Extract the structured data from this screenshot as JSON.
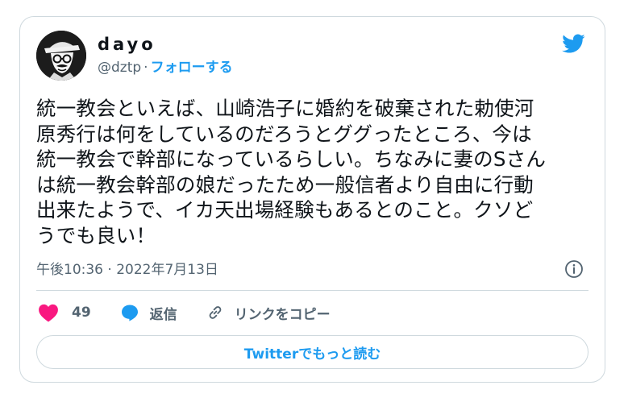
{
  "author": {
    "display_name": "dayo",
    "handle": "@dztp",
    "separator": "·",
    "follow_label": "フォローする"
  },
  "tweet": {
    "text": "統一教会といえば、山崎浩子に婚約を破棄された勅使河\n原秀行は何をしているのだろうとググったところ、今は\n統一教会で幹部になっているらしい。ちなみに妻のSさん\nは統一教会幹部の娘だったため一般信者より自由に行動\n出来たようで、イカ天出場経験もあるとのこと。クソど\nうでも良い！",
    "timestamp": "午後10:36 · 2022年7月13日"
  },
  "actions": {
    "like_count": "49",
    "reply_label": "返信",
    "copy_link_label": "リンクをコピー"
  },
  "read_more_label": "Twitterでもっと読む",
  "colors": {
    "accent": "#1d9bf0",
    "like": "#f91880",
    "secondary_text": "#536471",
    "border": "#cfd9de"
  },
  "icons": {
    "brand": "twitter-bird-icon",
    "info": "info-icon",
    "like": "heart-icon",
    "reply": "speech-bubble-icon",
    "copy_link": "link-icon"
  }
}
